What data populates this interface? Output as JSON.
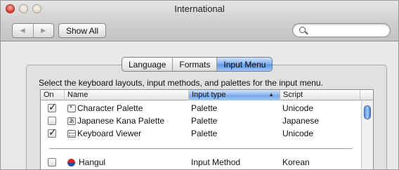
{
  "window": {
    "title": "International"
  },
  "toolbar": {
    "back_icon": "◀",
    "forward_icon": "▶",
    "show_all_label": "Show All",
    "search_placeholder": ""
  },
  "tabs": [
    {
      "label": "Language",
      "active": false
    },
    {
      "label": "Formats",
      "active": false
    },
    {
      "label": "Input Menu",
      "active": true
    }
  ],
  "panel": {
    "instruction": "Select the keyboard layouts, input methods, and palettes for the input menu."
  },
  "list": {
    "columns": [
      "On",
      "Name",
      "Input type",
      "Script"
    ],
    "sorted_column": "Input type",
    "sort_indicator": "▲",
    "rows": [
      {
        "checked": true,
        "icon": "character-palette-icon",
        "name": "Character Palette",
        "type": "Palette",
        "script": "Unicode"
      },
      {
        "checked": false,
        "icon": "kana-palette-icon",
        "name": "Japanese Kana Palette",
        "type": "Palette",
        "script": "Japanese"
      },
      {
        "checked": true,
        "icon": "keyboard-viewer-icon",
        "name": "Keyboard Viewer",
        "type": "Palette",
        "script": "Unicode"
      },
      {
        "checked": false,
        "icon": "korean-flag-icon",
        "name": "Hangul",
        "type": "Input Method",
        "script": "Korean"
      }
    ]
  },
  "colors": {
    "selection_blue": "#6fa3e7",
    "window_bg": "#e9e9e9",
    "close_red": "#e0473b"
  }
}
